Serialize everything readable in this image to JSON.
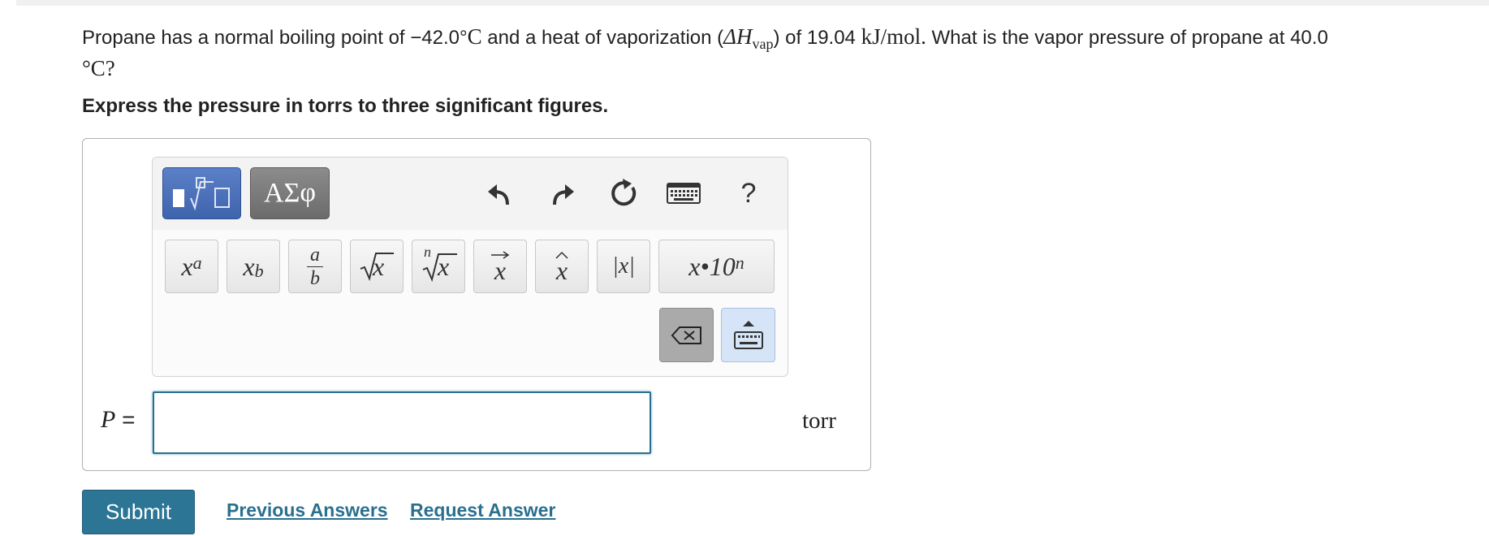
{
  "question": {
    "p1": "Propane has a normal boiling point of ",
    "temp1": "−42.0°",
    "temp1_unit": "C",
    "p2": " and a heat of vaporization (",
    "delta_h": "ΔH",
    "vap_sub": "vap",
    "p3": ") of 19.04 ",
    "enthalpy_unit": "kJ/mol.",
    "p4": " What is the vapor pressure of propane at 40.0",
    "line2_unit": "°C?"
  },
  "instruction": "Express the pressure in torrs to three significant figures.",
  "toolbar": {
    "greek_label": "ΑΣφ",
    "help_label": "?",
    "templates": {
      "power_base": "x",
      "power_exp": "a",
      "sub_base": "x",
      "sub_idx": "b",
      "frac_num": "a",
      "frac_den": "b",
      "sqrt_arg": "x",
      "nthroot_idx": "n",
      "nthroot_arg": "x",
      "vector_arg": "x",
      "hat_arg": "x",
      "abs_label": "|x|",
      "sci_label": "x•10",
      "sci_exp": "n"
    },
    "icons": {
      "math_mode": "square-root-template-icon",
      "undo": "undo-icon",
      "redo": "redo-icon",
      "reset": "reset-icon",
      "keyboard": "keyboard-icon",
      "backspace": "backspace-icon",
      "keyboard_toggle": "keyboard-toggle-icon"
    }
  },
  "answer": {
    "variable": "P",
    "equals": " =",
    "value": "",
    "unit": "torr"
  },
  "actions": {
    "submit": "Submit",
    "previous_answers": "Previous Answers",
    "request_answer": "Request Answer"
  },
  "colors": {
    "accent": "#2c7595",
    "math_mode_btn": "#4a6fb8",
    "greek_mode_btn": "#7a7a7a",
    "keyboard_toggle_bg": "#d6e4f7"
  }
}
